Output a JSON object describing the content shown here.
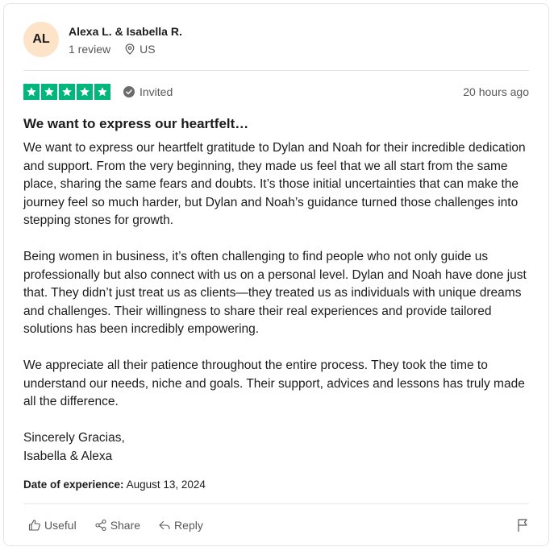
{
  "consumer": {
    "initials": "AL",
    "name": "Alexa L. & Isabella R.",
    "review_count": "1 review",
    "country": "US"
  },
  "review": {
    "rating": 5,
    "status": "Invited",
    "posted": "20 hours ago",
    "title": "We want to express our heartfelt…",
    "paragraphs": [
      "We want to express our heartfelt gratitude to Dylan and Noah for their incredible dedication and support. From the very beginning, they made us feel that we all start from the same place, sharing the same fears and doubts. It’s those initial uncertainties that can make the journey feel so much harder, but Dylan and Noah’s guidance turned those challenges into stepping stones for growth.",
      "Being women in business, it’s often challenging to find people who not only guide us professionally but also connect with us on a personal level. Dylan and Noah have done just that. They didn’t just treat us as clients—they treated us as individuals with unique dreams and challenges. Their willingness to share their real experiences and provide tailored solutions has been incredibly empowering.",
      "We appreciate all their patience throughout the entire process. They took the time to understand our needs, niche and goals. Their support, advices and lessons has truly made all the difference.",
      "Sincerely Gracias,\nIsabella & Alexa"
    ],
    "experience_label": "Date of experience:",
    "experience_date": "August 13, 2024"
  },
  "actions": {
    "useful": "Useful",
    "share": "Share",
    "reply": "Reply"
  },
  "colors": {
    "star_green": "#00b67a",
    "avatar_bg": "#fde3c8",
    "muted_text": "#575757"
  },
  "icons": [
    "location-pin-icon",
    "star-icon",
    "verified-check-icon",
    "thumbs-up-icon",
    "share-icon",
    "reply-icon",
    "flag-icon"
  ]
}
